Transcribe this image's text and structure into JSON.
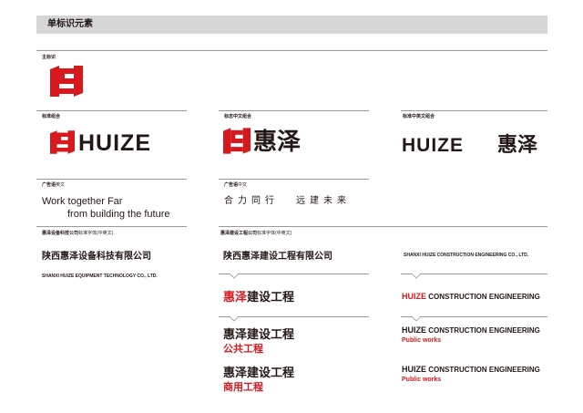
{
  "header": {
    "title": "单标识元素"
  },
  "sections": {
    "main_mark": {
      "label": "主标识"
    },
    "standard_combo": {
      "label": "标准组合"
    },
    "mark_cn": {
      "label": "标志中文组合"
    },
    "std_cn_en": {
      "label": "标准中英文组合"
    },
    "ad_en": {
      "label_prefix": "广告语",
      "label_suffix": "英文"
    },
    "ad_cn": {
      "label_prefix": "广告语",
      "label_suffix": "中文"
    },
    "equip_std": {
      "label_prefix": "惠泽设备科技公司",
      "label_suffix": "标准字体(中英文)"
    },
    "constr_std": {
      "label_prefix": "惠泽建设工程公司",
      "label_suffix": "标准字体(中英文)"
    }
  },
  "brand": {
    "wordmark": "HUIZE",
    "cn_name": "惠泽",
    "colors": {
      "red": "#d7191e",
      "dark": "#231815",
      "rule": "#9a9a9a",
      "header_bg": "#d6d6d6"
    }
  },
  "slogan_en": {
    "line1": "Work together  Far",
    "line2": "from building the future"
  },
  "slogan_cn": {
    "part1": "合力同行",
    "part2": "远建未来"
  },
  "equip": {
    "cn": "陕西惠泽设备科技有限公司",
    "en": "SHANXI HUIZE EQUIPMENT TECHNOLOGY CO., LTD."
  },
  "constr": {
    "cn_full": "陕西惠泽建设工程有限公司",
    "en_full": "SHANXI HUIZE CONSTRUCTION ENGINEERING CO., LTD.",
    "cn_brand": "惠泽",
    "cn_rest": "建设工程",
    "en_brand": "HUIZE",
    "en_rest": "CONSTRUCTION ENGINEERING",
    "public_cn": "公共工程",
    "commercial_cn": "商用工程",
    "public_en": "Public works"
  }
}
